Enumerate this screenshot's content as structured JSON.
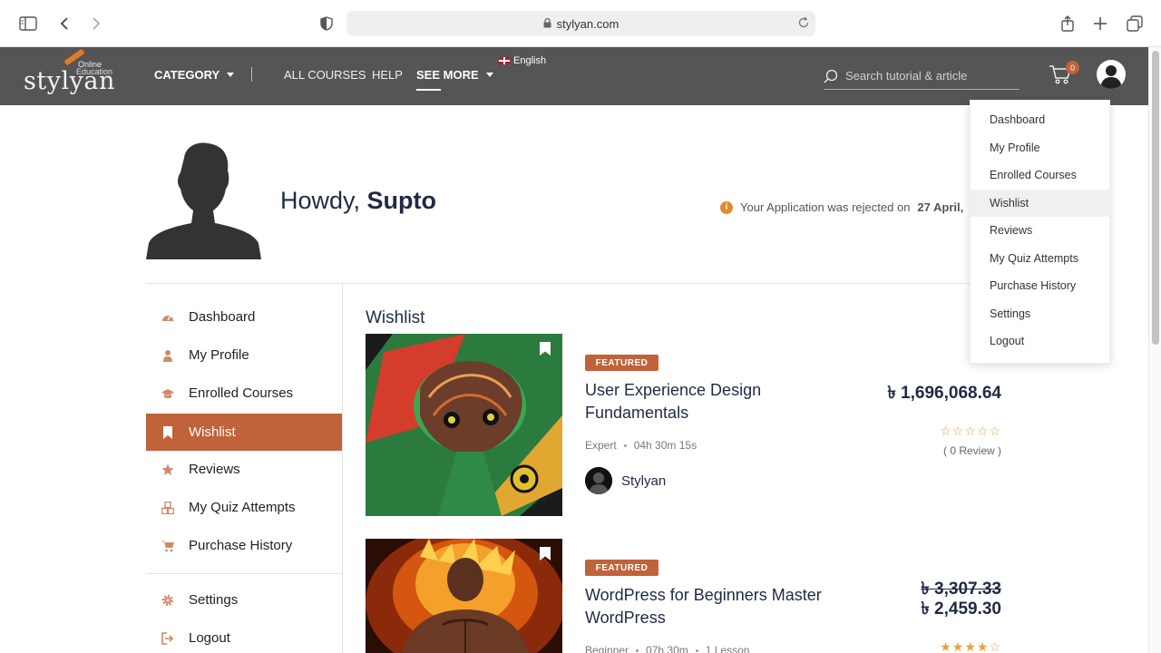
{
  "browser": {
    "url": "stylyan.com"
  },
  "nav": {
    "logo_word": "stylyan",
    "logo_sub1": "Online",
    "logo_sub2": "Education",
    "category": "CATEGORY",
    "all_courses": "ALL COURSES",
    "help": "HELP",
    "see_more": "SEE MORE",
    "language": "English",
    "search_placeholder": "Search tutorial & article",
    "cart_count": "0"
  },
  "profile": {
    "greeting": "Howdy,",
    "name": "Supto",
    "notice_text": "Your Application was rejected on",
    "notice_date": "27 April,"
  },
  "sidebar": {
    "items": [
      {
        "label": "Dashboard",
        "icon": "dashboard-icon"
      },
      {
        "label": "My Profile",
        "icon": "user-icon"
      },
      {
        "label": "Enrolled Courses",
        "icon": "graduation-cap-icon"
      },
      {
        "label": "Wishlist",
        "icon": "bookmark-icon"
      },
      {
        "label": "Reviews",
        "icon": "star-icon"
      },
      {
        "label": "My Quiz Attempts",
        "icon": "cubes-icon"
      },
      {
        "label": "Purchase History",
        "icon": "cart-icon"
      },
      {
        "label": "Settings",
        "icon": "gear-icon"
      },
      {
        "label": "Logout",
        "icon": "logout-icon"
      }
    ]
  },
  "wishlist": {
    "title": "Wishlist",
    "courses": [
      {
        "badge": "FEATURED",
        "title": "User Experience Design Fundamentals",
        "level": "Expert",
        "duration": "04h 30m 15s",
        "author": "Stylyan",
        "price": "৳ 1,696,068.64",
        "stars": "☆☆☆☆☆",
        "reviews": "( 0 Review )"
      },
      {
        "badge": "FEATURED",
        "title": "WordPress for Beginners Master WordPress",
        "level": "Beginner",
        "duration": "07h 30m",
        "lessons": "1 Lesson",
        "old_price": "৳ 3,307.33",
        "price": "৳ 2,459.30",
        "stars": "★★★★☆"
      }
    ]
  },
  "dropdown": {
    "items": [
      "Dashboard",
      "My Profile",
      "Enrolled Courses",
      "Wishlist",
      "Reviews",
      "My Quiz Attempts",
      "Purchase History",
      "Settings",
      "Logout"
    ]
  },
  "colors": {
    "accent": "#c0623a",
    "nav_bg": "#555555",
    "text_dark": "#1f2a44",
    "star": "#e9a23b"
  }
}
